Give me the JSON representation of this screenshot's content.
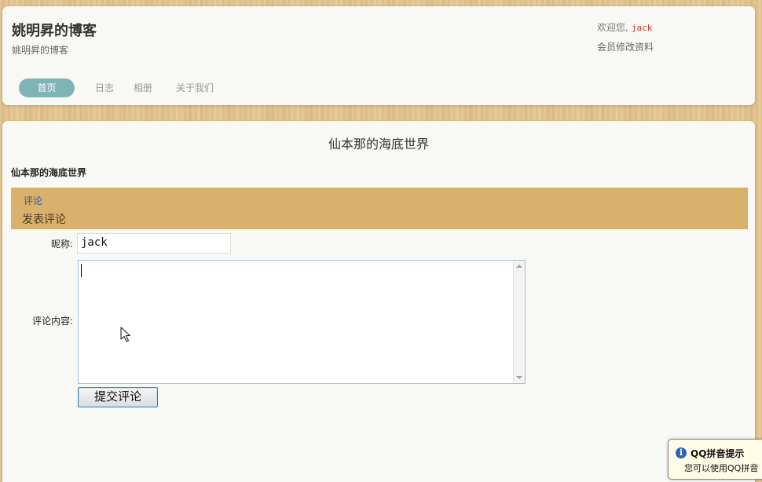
{
  "header": {
    "site_title": "姚明昇的博客",
    "site_subtitle": "姚明昇的博客",
    "welcome_text": "欢迎您,",
    "username": "jack",
    "profile_link": "会员修改资料",
    "nav": [
      "首页",
      "日志",
      "相册",
      "关于我们"
    ]
  },
  "post": {
    "title": "仙本那的海底世界",
    "section_heading": "仙本那的海底世界"
  },
  "comments": {
    "tab_label": "评论",
    "section_label": "发表评论",
    "nickname_label": "昵称:",
    "nickname_value": "jack",
    "content_label": "评论内容:",
    "content_value": "",
    "submit_label": "提交评论"
  },
  "tooltip": {
    "icon": "info-icon",
    "title": "QQ拼音提示",
    "body": "您可以使用QQ拼音"
  },
  "colors": {
    "nav_active": "#7fb3b7",
    "comment_bar": "#d9b06c",
    "username": "#c0392b",
    "link_blue": "#1f5fa8"
  }
}
